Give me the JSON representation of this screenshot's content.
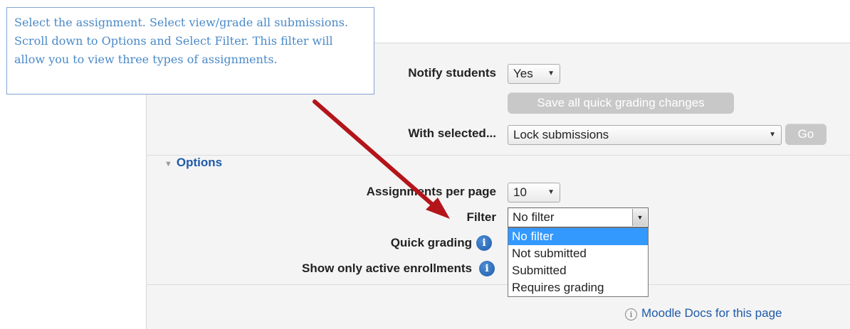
{
  "callout": {
    "text": "Select the assignment. Select view/grade all submissions. Scroll down to Options and Select Filter. This filter will allow you to view three types of assignments."
  },
  "quick_grading_form": {
    "notify_students_label": "Notify students",
    "notify_students_value": "Yes",
    "save_button": "Save all quick grading changes",
    "with_selected_label": "With selected...",
    "with_selected_value": "Lock submissions",
    "go_button": "Go"
  },
  "options": {
    "heading": "Options",
    "assignments_per_page_label": "Assignments per page",
    "assignments_per_page_value": "10",
    "filter_label": "Filter",
    "filter_value": "No filter",
    "filter_options": [
      "No filter",
      "Not submitted",
      "Submitted",
      "Requires grading"
    ],
    "quick_grading_label": "Quick grading",
    "show_active_label": "Show only active enrollments"
  },
  "footer": {
    "docs_link": "Moodle Docs for this page"
  },
  "colors": {
    "arrow": "#b3151b",
    "callout_text": "#4a8ac8",
    "highlight": "#3399ff"
  }
}
